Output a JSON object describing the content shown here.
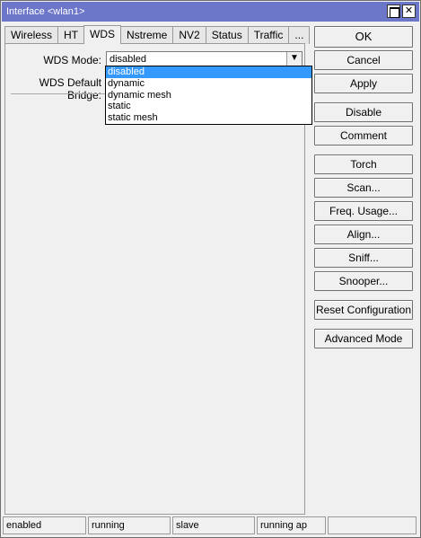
{
  "window": {
    "title": "Interface <wlan1>"
  },
  "tabs": [
    {
      "label": "Wireless"
    },
    {
      "label": "HT"
    },
    {
      "label": "WDS"
    },
    {
      "label": "Nstreme"
    },
    {
      "label": "NV2"
    },
    {
      "label": "Status"
    },
    {
      "label": "Traffic"
    },
    {
      "label": "..."
    }
  ],
  "form": {
    "wds_mode_label": "WDS Mode:",
    "wds_mode_value": "disabled",
    "wds_default_bridge_label": "WDS Default Bridge:"
  },
  "dropdown": {
    "options": [
      "disabled",
      "dynamic",
      "dynamic mesh",
      "static",
      "static mesh"
    ],
    "selected": "disabled"
  },
  "buttons": {
    "ok": "OK",
    "cancel": "Cancel",
    "apply": "Apply",
    "disable": "Disable",
    "comment": "Comment",
    "torch": "Torch",
    "scan": "Scan...",
    "freq_usage": "Freq. Usage...",
    "align": "Align...",
    "sniff": "Sniff...",
    "snooper": "Snooper...",
    "reset_configuration": "Reset Configuration",
    "advanced_mode": "Advanced Mode"
  },
  "status": [
    "enabled",
    "running",
    "slave",
    "running ap",
    ""
  ],
  "colors": {
    "titlebar": "#6c77c9",
    "selection": "#3399ff"
  }
}
